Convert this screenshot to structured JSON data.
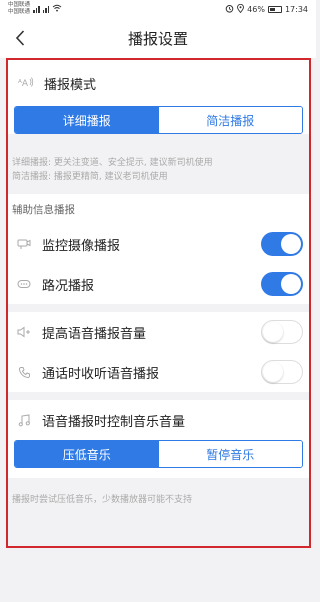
{
  "status": {
    "carrier1": "中国联通",
    "carrier2": "中国联通",
    "battery": "46%",
    "time": "17:34"
  },
  "nav": {
    "title": "播报设置"
  },
  "mode": {
    "title": "播报模式",
    "options": [
      "详细播报",
      "简洁播报"
    ],
    "selected": "详细播报",
    "hint1": "详细播报: 更关注变道、安全提示, 建议新司机使用",
    "hint2": "简洁播报: 播报更精简, 建议老司机使用"
  },
  "aux": {
    "label": "辅助信息播报",
    "items": [
      {
        "label": "监控摄像播报",
        "on": true
      },
      {
        "label": "路况播报",
        "on": true
      }
    ]
  },
  "voice": {
    "items": [
      {
        "label": "提高语音播报音量",
        "on": false
      },
      {
        "label": "通话时收听语音播报",
        "on": false
      }
    ]
  },
  "music": {
    "title": "语音播报时控制音乐音量",
    "options": [
      "压低音乐",
      "暂停音乐"
    ],
    "selected": "压低音乐",
    "hint": "播报时尝试压低音乐，少数播放器可能不支持"
  },
  "colors": {
    "accent": "#2f7ae5",
    "highlight_border": "#d0282d"
  }
}
